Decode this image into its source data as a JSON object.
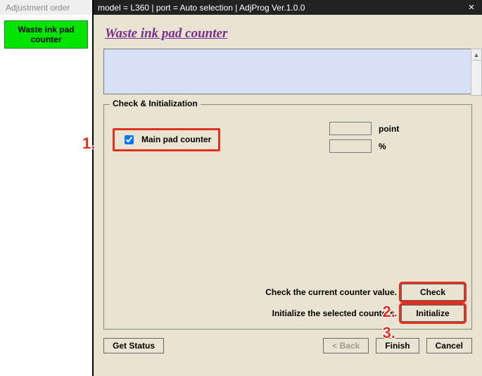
{
  "sidebar": {
    "title": "Adjustment order",
    "nav_label": "Waste ink pad counter"
  },
  "window": {
    "title": "model = L360 | port = Auto selection | AdjProg Ver.1.0.0",
    "close_glyph": "×"
  },
  "page": {
    "heading": "Waste ink pad counter"
  },
  "group": {
    "legend": "Check & Initialization",
    "checkbox_label": "Main pad counter",
    "unit_point": "point",
    "unit_percent": "%",
    "check_hint": "Check the current counter value.",
    "init_hint": "Initialize the selected counters.",
    "check_btn": "Check",
    "init_btn": "Initialize"
  },
  "bottom": {
    "get_status": "Get Status",
    "back": "< Back",
    "finish": "Finish",
    "cancel": "Cancel"
  },
  "markers": {
    "m1": "1.",
    "m2": "2.",
    "m3": "3."
  }
}
